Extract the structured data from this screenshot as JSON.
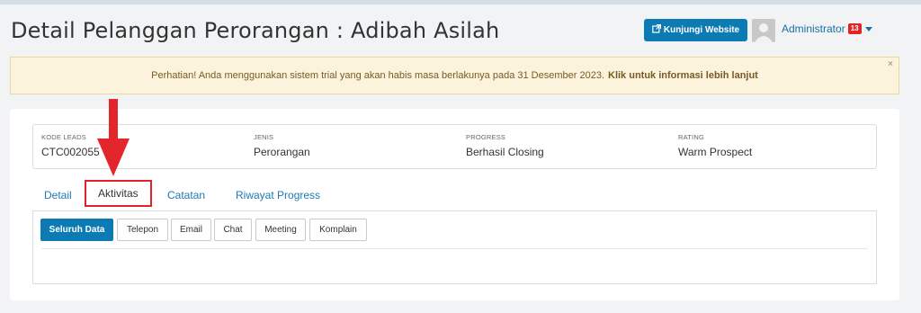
{
  "header": {
    "title": "Detail Pelanggan Perorangan : Adibah Asilah",
    "visit_label": "Kunjungi Website",
    "user_name": "Administrator",
    "notif_count": "13"
  },
  "alert": {
    "message": "Perhatian! Anda menggunakan sistem trial yang akan habis masa berlakunya pada 31 Desember 2023.",
    "link": "Klik untuk informasi lebih lanjut",
    "close": "×"
  },
  "info": {
    "code_key": "KODE LEADS",
    "code_val": "CTC002055",
    "type_key": "JENIS",
    "type_val": "Perorangan",
    "progress_key": "PROGRESS",
    "progress_val": "Berhasil Closing",
    "rating_key": "RATING",
    "rating_val": "Warm Prospect"
  },
  "tabs": {
    "detail": "Detail",
    "aktivitas": "Aktivitas",
    "catatan": "Catatan",
    "riwayat": "Riwayat Progress"
  },
  "filters": {
    "all": "Seluruh Data",
    "phone": "Telepon",
    "email": "Email",
    "chat": "Chat",
    "meeting": "Meeting",
    "complaint": "Komplain"
  },
  "colors": {
    "primary": "#0c7bb3",
    "highlight": "#e0222b",
    "alert_bg": "#fbf3dc"
  },
  "icons": {
    "visit": "external-link-icon",
    "avatar": "user-avatar-icon",
    "annotation": "red-arrow-down-icon"
  }
}
